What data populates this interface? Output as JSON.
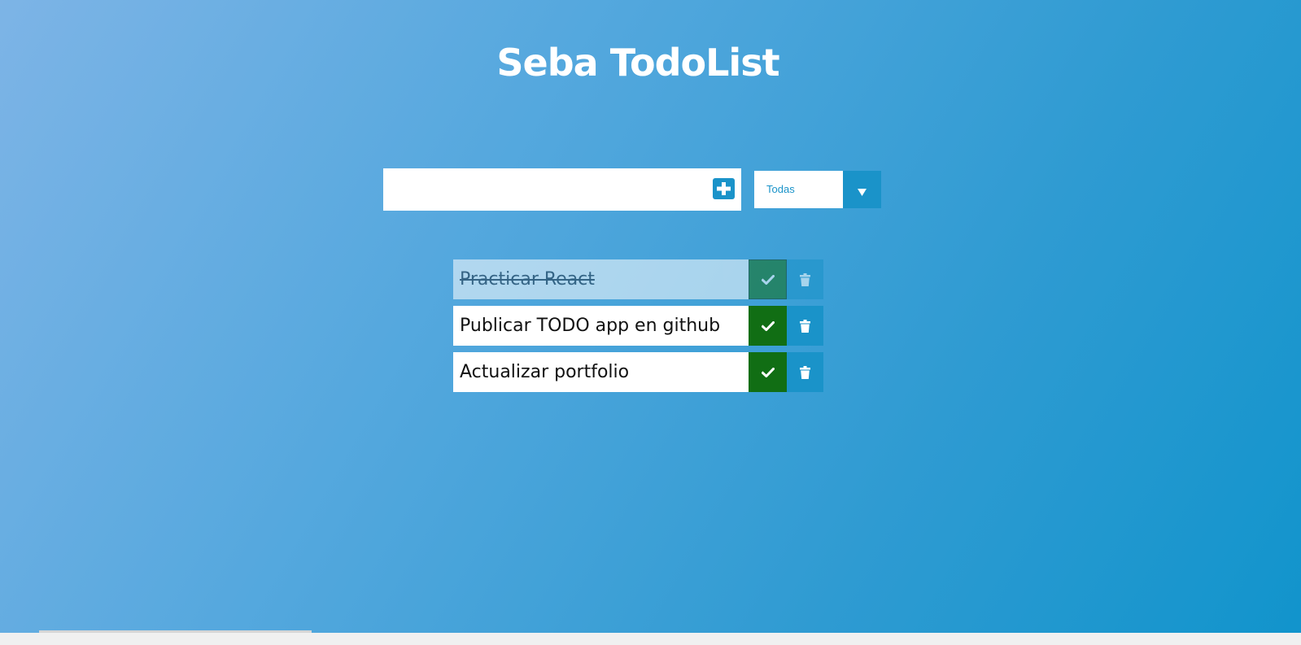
{
  "header": {
    "title": "Seba TodoList"
  },
  "form": {
    "input_value": "",
    "add_icon": "plus-square-icon",
    "filter": {
      "selected": "Todas",
      "arrow_icon": "triangle-down-icon"
    }
  },
  "todos": [
    {
      "text": "Practicar React",
      "completed": true
    },
    {
      "text": "Publicar TODO app en github",
      "completed": false
    },
    {
      "text": "Actualizar portfolio",
      "completed": false
    }
  ],
  "icons": {
    "complete": "check-icon",
    "delete": "trash-icon"
  },
  "colors": {
    "accent": "#1a93c9",
    "complete": "#116e14",
    "background_start": "#7db4e6",
    "background_end": "#1194cc"
  }
}
